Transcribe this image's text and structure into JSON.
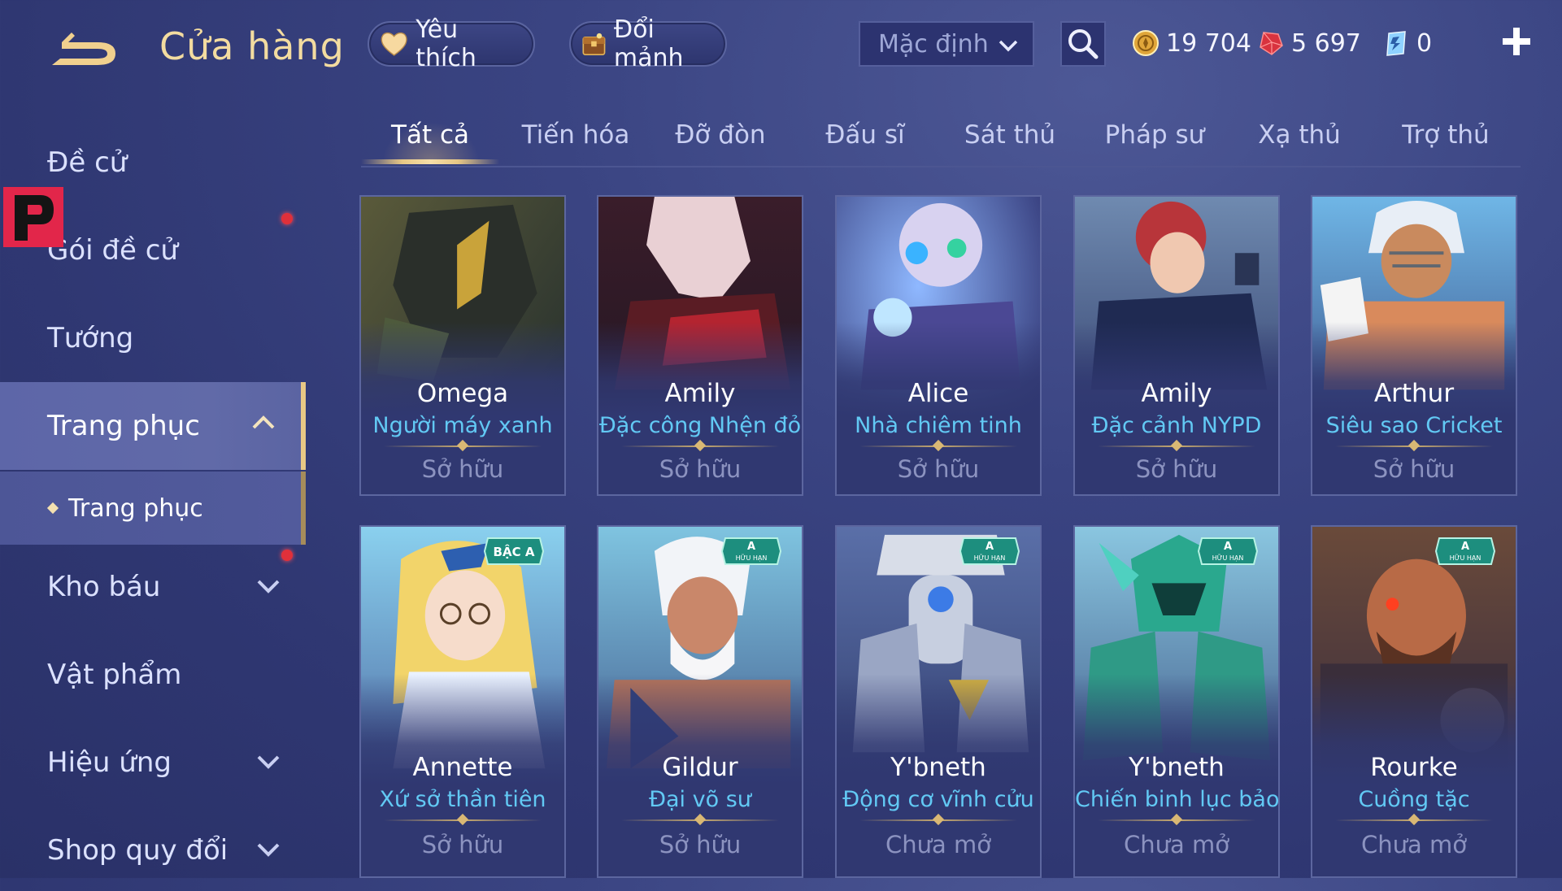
{
  "header": {
    "title": "Cửa hàng",
    "favorite_label": "Yêu thích",
    "fragments_label": "Đổi mảnh",
    "sort_selected": "Mặc định"
  },
  "currency": {
    "gold": "19 704",
    "ruby": "5 697",
    "voucher": "0"
  },
  "sidebar": {
    "items": [
      {
        "label": "Đề cử"
      },
      {
        "label": "Gói đề cử"
      },
      {
        "label": "Tướng"
      },
      {
        "label": "Trang phục"
      },
      {
        "label": "Kho báu"
      },
      {
        "label": "Vật phẩm"
      },
      {
        "label": "Hiệu ứng"
      },
      {
        "label": "Shop quy đổi"
      }
    ],
    "sub_item": "Trang phục"
  },
  "tabs": [
    "Tất cả",
    "Tiến hóa",
    "Đỡ đòn",
    "Đấu sĩ",
    "Sát thủ",
    "Pháp sư",
    "Xạ thủ",
    "Trợ thủ"
  ],
  "cards": [
    {
      "hero": "Omega",
      "skin": "Người máy xanh",
      "status": "Sở hữu",
      "badge": ""
    },
    {
      "hero": "Amily",
      "skin": "Đặc công Nhện đỏ",
      "status": "Sở hữu",
      "badge": ""
    },
    {
      "hero": "Alice",
      "skin": "Nhà chiêm tinh",
      "status": "Sở hữu",
      "badge": ""
    },
    {
      "hero": "Amily",
      "skin": "Đặc cảnh NYPD",
      "status": "Sở hữu",
      "badge": ""
    },
    {
      "hero": "Arthur",
      "skin": "Siêu sao Cricket",
      "status": "Sở hữu",
      "badge": ""
    },
    {
      "hero": "Annette",
      "skin": "Xứ sở thần tiên",
      "status": "Sở hữu",
      "badge": "BẬC A"
    },
    {
      "hero": "Gildur",
      "skin": "Đại võ sư",
      "status": "Sở hữu",
      "badge_grade": "A",
      "badge_sub": "HỮU HẠN"
    },
    {
      "hero": "Y'bneth",
      "skin": "Động cơ vĩnh cửu",
      "status": "Chưa mở",
      "badge_grade": "A",
      "badge_sub": "HỮU HẠN"
    },
    {
      "hero": "Y'bneth",
      "skin": "Chiến binh lục bảo",
      "status": "Chưa mở",
      "badge_grade": "A",
      "badge_sub": "HỮU HẠN"
    },
    {
      "hero": "Rourke",
      "skin": "Cuồng tặc",
      "status": "Chưa mở",
      "badge_grade": "A",
      "badge_sub": "HỮU HẠN"
    }
  ],
  "colors": {
    "accent_gold": "#e8c885",
    "skin_text": "#62c9f4",
    "notification": "#e0303a"
  },
  "icons": [
    "back-arrow-icon",
    "heart-icon",
    "chest-icon",
    "chevron-down-icon",
    "search-icon",
    "gold-coin-icon",
    "ruby-icon",
    "voucher-icon",
    "plus-icon",
    "chevron-up-icon"
  ]
}
